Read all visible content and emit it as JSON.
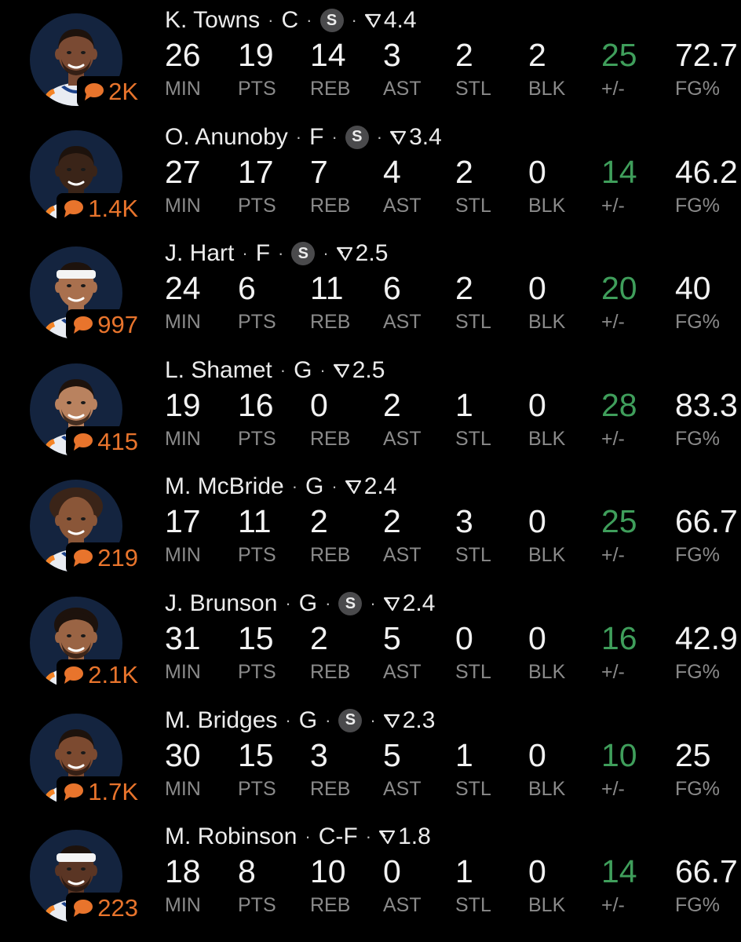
{
  "colors": {
    "background": "#000000",
    "stat_value": "#f2f2f2",
    "stat_label": "#8a8a8a",
    "plus_minus_positive": "#3f9e5b",
    "comment_accent": "#e8742c",
    "starter_badge_bg": "#4a4a4c",
    "avatar_bg": "#14243f"
  },
  "icons": {
    "comment": "speech-bubble-icon",
    "rating": "triangle-down-icon",
    "starter": "S"
  },
  "stat_labels": [
    "MIN",
    "PTS",
    "REB",
    "AST",
    "STL",
    "BLK",
    "+/-",
    "FG%"
  ],
  "players": [
    {
      "name": "K. Towns",
      "position": "C",
      "starter": true,
      "rating": "4.4",
      "comments": "2K",
      "stats": [
        "26",
        "19",
        "14",
        "3",
        "2",
        "2",
        "25",
        "72.7"
      ]
    },
    {
      "name": "O. Anunoby",
      "position": "F",
      "starter": true,
      "rating": "3.4",
      "comments": "1.4K",
      "stats": [
        "27",
        "17",
        "7",
        "4",
        "2",
        "0",
        "14",
        "46.2"
      ]
    },
    {
      "name": "J. Hart",
      "position": "F",
      "starter": true,
      "rating": "2.5",
      "comments": "997",
      "stats": [
        "24",
        "6",
        "11",
        "6",
        "2",
        "0",
        "20",
        "40"
      ]
    },
    {
      "name": "L. Shamet",
      "position": "G",
      "starter": false,
      "rating": "2.5",
      "comments": "415",
      "stats": [
        "19",
        "16",
        "0",
        "2",
        "1",
        "0",
        "28",
        "83.3"
      ]
    },
    {
      "name": "M. McBride",
      "position": "G",
      "starter": false,
      "rating": "2.4",
      "comments": "219",
      "stats": [
        "17",
        "11",
        "2",
        "2",
        "3",
        "0",
        "25",
        "66.7"
      ]
    },
    {
      "name": "J. Brunson",
      "position": "G",
      "starter": true,
      "rating": "2.4",
      "comments": "2.1K",
      "stats": [
        "31",
        "15",
        "2",
        "5",
        "0",
        "0",
        "16",
        "42.9"
      ]
    },
    {
      "name": "M. Bridges",
      "position": "G",
      "starter": true,
      "rating": "2.3",
      "comments": "1.7K",
      "stats": [
        "30",
        "15",
        "3",
        "5",
        "1",
        "0",
        "10",
        "25"
      ]
    },
    {
      "name": "M. Robinson",
      "position": "C-F",
      "starter": false,
      "rating": "1.8",
      "comments": "223",
      "stats": [
        "18",
        "8",
        "10",
        "0",
        "1",
        "0",
        "14",
        "66.7"
      ]
    }
  ]
}
